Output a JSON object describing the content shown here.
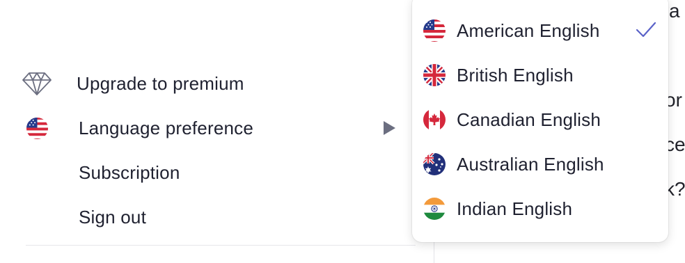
{
  "menu": {
    "items": [
      {
        "label": "Upgrade to premium",
        "icon": "diamond-icon"
      },
      {
        "label": "Language preference",
        "icon": "us-flag-icon",
        "submenu_indicator": "triangle-right-icon"
      },
      {
        "label": "Subscription"
      },
      {
        "label": "Sign out"
      }
    ]
  },
  "language_submenu": {
    "selected": "American English",
    "options": [
      {
        "label": "American English",
        "icon": "us-flag-icon",
        "checked": true
      },
      {
        "label": "British English",
        "icon": "uk-flag-icon",
        "checked": false
      },
      {
        "label": "Canadian English",
        "icon": "canada-flag-icon",
        "checked": false
      },
      {
        "label": "Australian English",
        "icon": "australia-flag-icon",
        "checked": false
      },
      {
        "label": "Indian English",
        "icon": "india-flag-icon",
        "checked": false
      }
    ]
  },
  "background_text": [
    "a",
    "or",
    "ce",
    "k?"
  ],
  "colors": {
    "text": "#1f2130",
    "icon_gray": "#6b6e80",
    "checkmark": "#5a62c8",
    "divider": "#e6e6ea"
  }
}
